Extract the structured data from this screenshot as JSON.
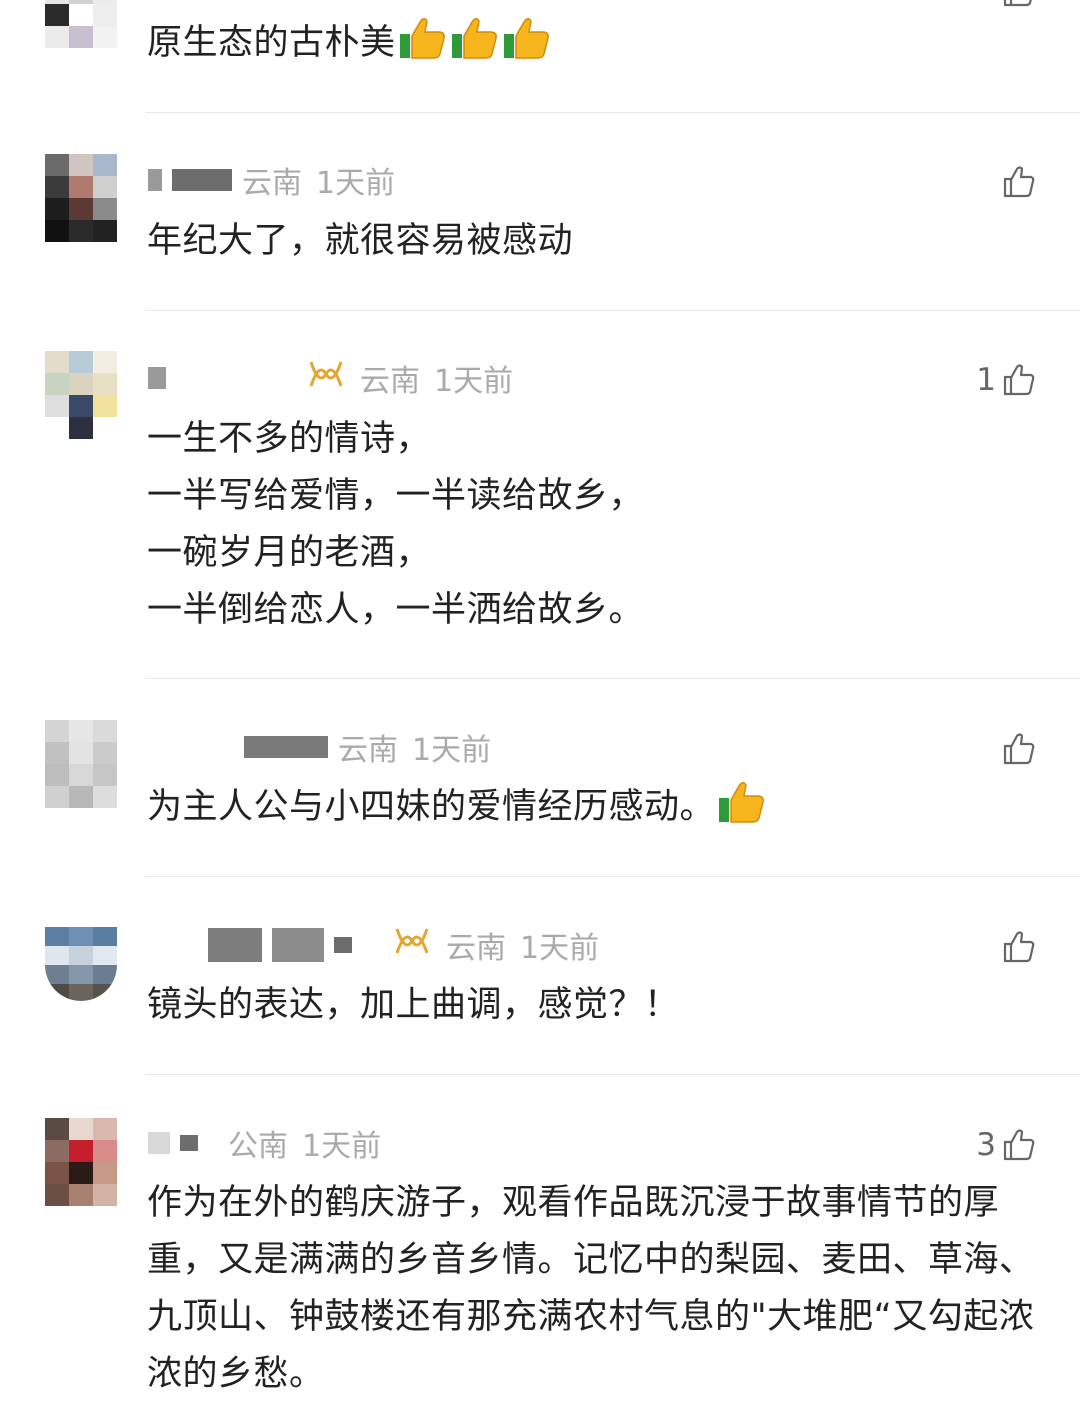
{
  "comments": [
    {
      "user": "",
      "location": "",
      "time": "",
      "text": "原生态的古朴美",
      "likes": "",
      "emoji_count": 3
    },
    {
      "user": "",
      "location": "云南",
      "time": "1天前",
      "text": "年纪大了，就很容易被感动",
      "likes": ""
    },
    {
      "user": "",
      "location": "云南",
      "time": "1天前",
      "badge": "vip-badge-icon",
      "text": "一生不多的情诗，\n一半写给爱情，一半读给故乡，\n一碗岁月的老酒，\n一半倒给恋人，一半洒给故乡。",
      "likes": "1"
    },
    {
      "user": "",
      "location": "云南",
      "time": "1天前",
      "text": "为主人公与小四妹的爱情经历感动。",
      "likes": "",
      "emoji_count": 1
    },
    {
      "user": "",
      "location": "云南",
      "time": "1天前",
      "badge": "vip-badge-icon",
      "text": "镜头的表达，加上曲调，感觉？！",
      "likes": ""
    },
    {
      "user": "",
      "location": "公南",
      "time": "1天前",
      "text": "作为在外的鹤庆游子，观看作品既沉浸于故事情节的厚重，又是满满的乡音乡情。记忆中的梨园、麦田、草海、九顶山、钟鼓楼还有那充满农村气息的\"大堆肥“又勾起浓浓的乡愁。",
      "likes": "3"
    }
  ],
  "colors": {
    "meta_text": "#aaaaaa",
    "body_text": "#222222",
    "badge_gold": "#e3a72f",
    "divider": "#e8e8e8"
  }
}
